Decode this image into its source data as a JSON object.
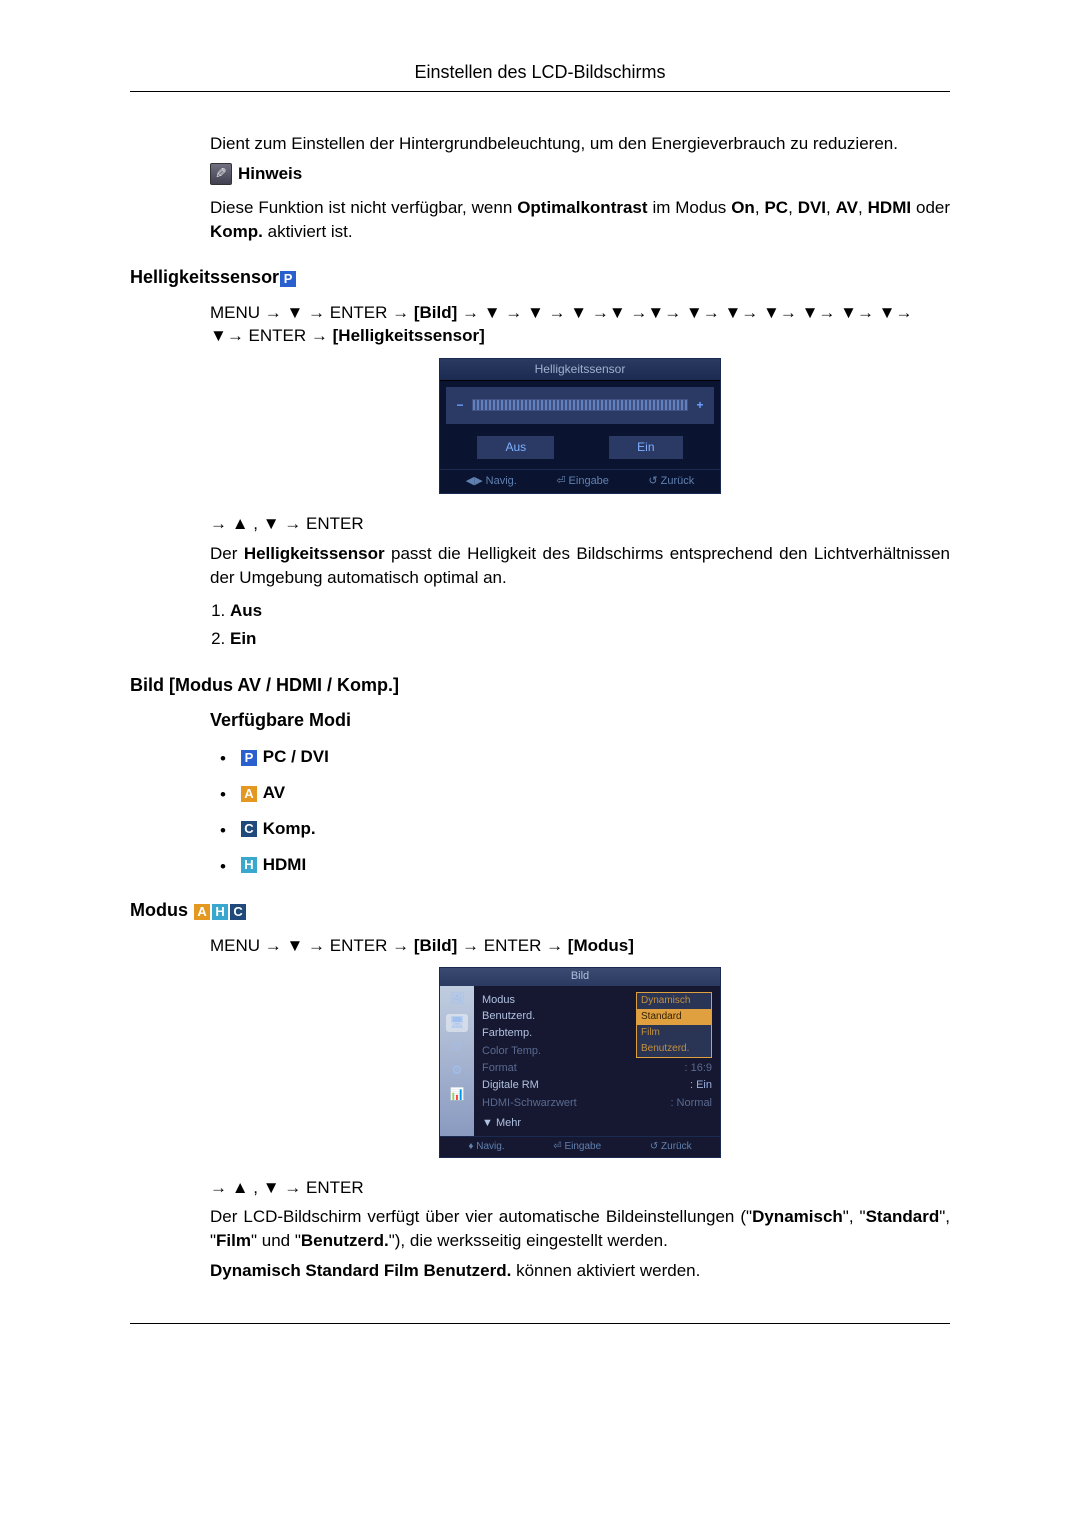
{
  "header": {
    "title": "Einstellen des LCD-Bildschirms"
  },
  "intro": {
    "desc": "Dient zum Einstellen der Hintergrundbeleuchtung, um den Energieverbrauch zu reduzieren.",
    "note_label": "Hinweis",
    "note_pre": "Diese Funktion ist nicht verfügbar, wenn ",
    "note_term1": "Optimalkontrast",
    "note_mid1": " im Modus ",
    "note_on": "On",
    "note_s1": ", ",
    "note_pc": "PC",
    "note_s2": ", ",
    "note_dvi": "DVI",
    "note_s3": ", ",
    "note_av": "AV",
    "note_s4": ", ",
    "note_hdmi": "HDMI",
    "note_mid2": " oder ",
    "note_komp": "Komp.",
    "note_end": " aktiviert ist."
  },
  "hellig": {
    "heading": "Helligkeitssensor",
    "badge": "P",
    "nav1a": "MENU → ▼ → ENTER → ",
    "nav1_bild": "[Bild]",
    "nav1b": " → ▼ → ▼ → ▼ →▼ →▼→ ▼→ ▼→ ▼→ ▼→ ▼→ ▼→ ▼→ ENTER → ",
    "nav1_sensor": "[Helligkeitssensor]",
    "nav2": "→ ▲ , ▼ → ENTER",
    "desc_pre": "Der ",
    "desc_bold": "Helligkeitssensor",
    "desc_post": " passt die Helligkeit des Bildschirms entsprechend den Lichtverhältnissen der Umgebung automatisch optimal an.",
    "list": [
      "Aus",
      "Ein"
    ]
  },
  "osd1": {
    "title": "Helligkeitssensor",
    "minus": "−",
    "plus": "+",
    "btn_aus": "Aus",
    "btn_ein": "Ein",
    "foot_nav": "Navig.",
    "foot_enter": "Eingabe",
    "foot_back": "Zurück"
  },
  "bild": {
    "heading": "Bild [Modus AV / HDMI / Komp.]",
    "sub": "Verfügbare Modi",
    "modes": {
      "p": "PC / DVI",
      "a": "AV",
      "c": "Komp.",
      "h": "HDMI"
    }
  },
  "modus": {
    "heading": "Modus",
    "badges": [
      "A",
      "H",
      "C"
    ],
    "nav_a": "MENU → ▼ → ENTER → ",
    "nav_bild": "[Bild]",
    "nav_b": " → ENTER → ",
    "nav_modus": "[Modus]",
    "nav2": "→ ▲ , ▼ → ENTER",
    "p1_pre": "Der LCD-Bildschirm verfügt über vier automatische Bildeinstellungen (\"",
    "p1_dy": "Dynamisch",
    "p1_s1": "\", \"",
    "p1_st": "Standard",
    "p1_s2": "\", \"",
    "p1_fi": "Film",
    "p1_s3": "\" und \"",
    "p1_be": "Benutzerd.",
    "p1_end": "\"), die werksseitig eingestellt werden.",
    "p2_bold": "Dynamisch Standard Film Benutzerd.",
    "p2_end": " können aktiviert werden."
  },
  "osd2": {
    "title": "Bild",
    "rows": {
      "modus": "Modus",
      "benutz": "Benutzerd.",
      "farb": "Farbtemp.",
      "ctemp": "Color Temp.",
      "format": "Format",
      "format_v": ": 16:9",
      "dig": "Digitale RM",
      "dig_v": ": Ein",
      "hdmi": "HDMI-Schwarzwert",
      "hdmi_v": ": Normal"
    },
    "dd": [
      "Dynamisch",
      "Standard",
      "Film",
      "Benutzerd."
    ],
    "more": "▼  Mehr",
    "foot_nav": "Navig.",
    "foot_enter": "Eingabe",
    "foot_back": "Zurück",
    "colon": ":"
  }
}
